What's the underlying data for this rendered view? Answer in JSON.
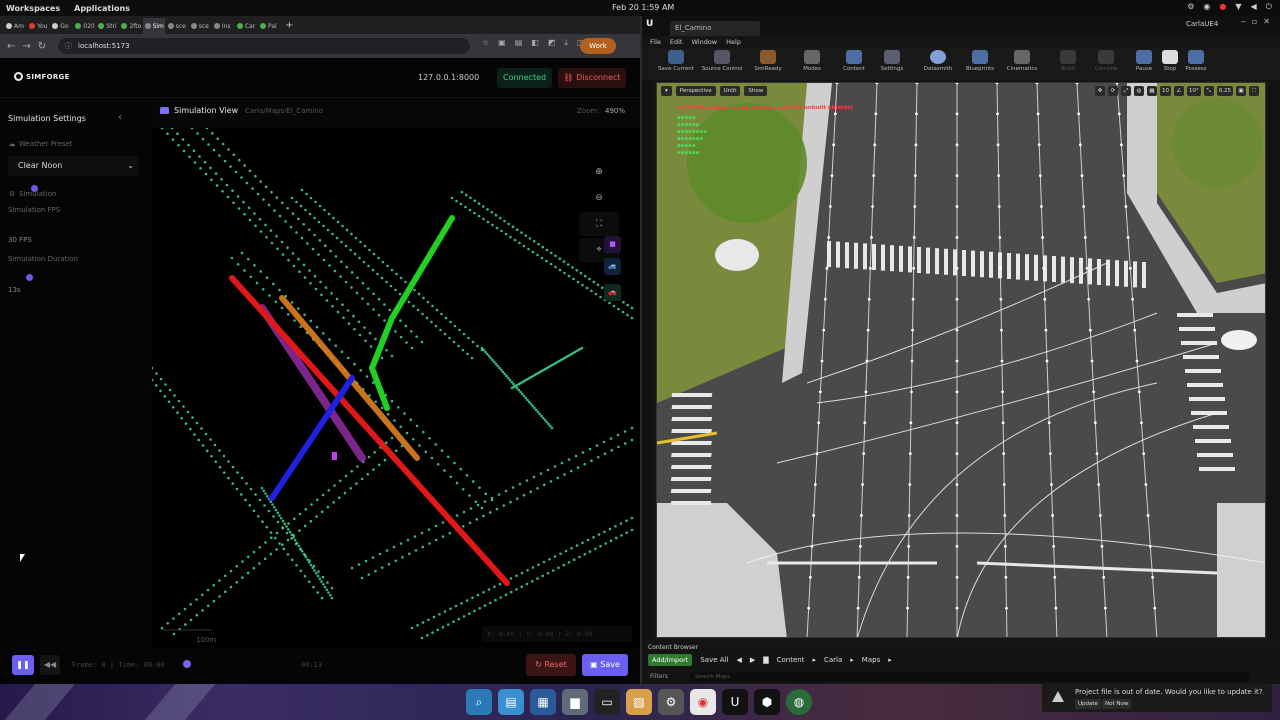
{
  "os": {
    "menus": [
      "Workspaces",
      "Applications"
    ],
    "clock": "Feb 20  1:59 AM"
  },
  "browser": {
    "tabs": [
      {
        "label": "Am",
        "color": "#cccccc"
      },
      {
        "label": "You",
        "color": "#e53935"
      },
      {
        "label": "Go",
        "color": "#cccccc"
      },
      {
        "label": "020",
        "color": "#cccccc"
      },
      {
        "label": "Stri",
        "color": "#cccccc"
      },
      {
        "label": "2fto",
        "color": "#cccccc"
      },
      {
        "label": "Sim",
        "color": "#cccccc"
      },
      {
        "label": "sce",
        "color": "#cccccc"
      },
      {
        "label": "sce",
        "color": "#cccccc"
      },
      {
        "label": "Ins",
        "color": "#cccccc"
      },
      {
        "label": "Car",
        "color": "#cccccc"
      },
      {
        "label": "Pal",
        "color": "#cccccc"
      }
    ],
    "url": "localhost:5173",
    "profile_label": "Work"
  },
  "app": {
    "logo_text": "SIMFORGE",
    "server": "127.0.0.1:8000",
    "status": "Connected",
    "disconnect_label": "Disconnect",
    "sidebar": {
      "title": "Simulation Settings",
      "weather_section": "Weather Preset",
      "weather_value": "Clear Noon",
      "simulation_section": "Simulation",
      "fps_label": "Simulation FPS",
      "fps_value": "30 FPS",
      "duration_label": "Simulation Duration",
      "duration_value": "13s"
    },
    "view": {
      "title": "Simulation View",
      "path": "Carla/Maps/El_Camino",
      "zoom_label": "Zoom:",
      "zoom_value": "490%",
      "scale_label": "100m",
      "coords": "X: 0.00 | Y: 0.00 | Z: 0.00"
    },
    "playback": {
      "frame_info": "Frame: 0 | Time: 00:00",
      "end_time": "00:13",
      "reset_label": "Reset",
      "save_label": "Save"
    }
  },
  "ue": {
    "tab_label": "El_Camino",
    "project": "CarlaUE4",
    "menu": [
      "File",
      "Edit",
      "Window",
      "Help"
    ],
    "toolbar": [
      "Save Current",
      "Source Control",
      "SimReady",
      "Modes",
      "Content",
      "Settings",
      "Datasmith",
      "Blueprints",
      "Cinematics",
      "Build",
      "Compile",
      "Pause",
      "Stop",
      "Possess"
    ],
    "viewport_buttons": [
      "Perspective",
      "Unlit",
      "Show"
    ],
    "viewport_right": [
      "10",
      "10°",
      "0.25"
    ],
    "warning": "LIGHTING NEEDS TO BE REBUILT (18,476 unbuilt objects)",
    "content_browser": {
      "tab": "Content Browser",
      "add_import": "Add/Import",
      "save_all": "Save All",
      "path": [
        "Content",
        "Carla",
        "Maps"
      ],
      "filters": "Filters",
      "search_placeholder": "Search Maps"
    }
  },
  "notification": {
    "text": "Project file is out of date. Would you like to update it?",
    "update_label": "Update",
    "not_now_label": "Not Now"
  },
  "colors": {
    "accent": "#6b5ef0",
    "connected": "#3fcf83",
    "danger": "#ef5b5b",
    "waypoint": "#3ddc97"
  }
}
